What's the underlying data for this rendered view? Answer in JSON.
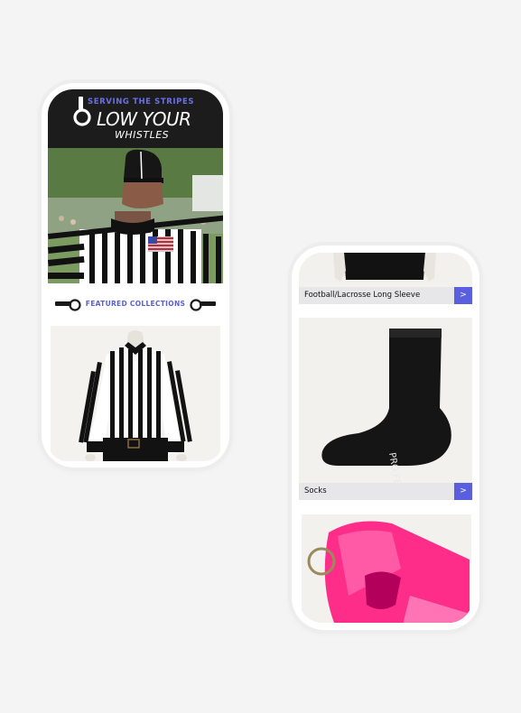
{
  "brand": {
    "tagline": "SERVING THE STRIPES",
    "logo_main": "LOW YOUR",
    "logo_sub": "WHISTLES"
  },
  "featured": {
    "label": "FEATURED COLLECTIONS"
  },
  "products": [
    {
      "name": "Football/Lacrosse Long Sleeve",
      "arrow": ">"
    },
    {
      "name": "Socks",
      "arrow": ">"
    }
  ],
  "sock_print": "PRO FEET",
  "colors": {
    "header_bg": "#1c1c1c",
    "accent": "#5a5fe0",
    "tagline": "#6a6fe8",
    "whistle": "#ff2d8a"
  }
}
